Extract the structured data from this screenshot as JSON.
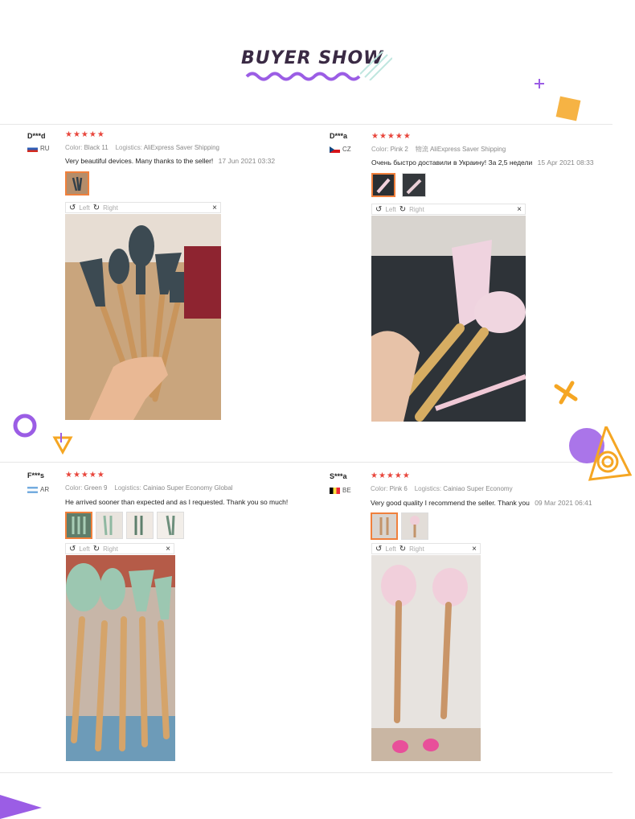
{
  "header": {
    "title": "BUYER SHOW"
  },
  "viewer": {
    "left_label": "Left",
    "right_label": "Right",
    "close_glyph": "×",
    "rotate_left_glyph": "↺",
    "rotate_right_glyph": "↻"
  },
  "reviews": [
    {
      "user": "D***d",
      "country": "RU",
      "stars": "★★★★★",
      "color_label": "Color:",
      "color_value": "Black 11",
      "logistics_label": "Logistics:",
      "logistics_value": "AliExpress Saver Shipping",
      "comment": "Very beautiful devices. Many thanks to the seller!",
      "date": "17 Jun 2021 03:32"
    },
    {
      "user": "D***a",
      "country": "CZ",
      "stars": "★★★★★",
      "color_label": "Color:",
      "color_value": "Pink 2",
      "logistics_label": "物流",
      "logistics_value": "AliExpress Saver Shipping",
      "comment": "Очень быстро доставили в Украину! За 2,5 недели",
      "date": "15 Apr 2021 08:33"
    },
    {
      "user": "F***s",
      "country": "AR",
      "stars": "★★★★★",
      "color_label": "Color:",
      "color_value": "Green 9",
      "logistics_label": "Logistics:",
      "logistics_value": "Cainiao Super Economy Global",
      "comment": "He arrived sooner than expected and as I requested. Thank you so much!",
      "date": ""
    },
    {
      "user": "S***a",
      "country": "BE",
      "stars": "★★★★★",
      "color_label": "Color:",
      "color_value": "Pink 6",
      "logistics_label": "Logistics:",
      "logistics_value": "Cainiao Super Economy",
      "comment": "Very good quality I recommend the seller. Thank you",
      "date": "09 Mar 2021 06:41"
    }
  ],
  "colors": {
    "accent_purple": "#9b5de5",
    "accent_orange": "#f5a623",
    "star_red": "#e8463c",
    "selected_border": "#f0803c"
  }
}
